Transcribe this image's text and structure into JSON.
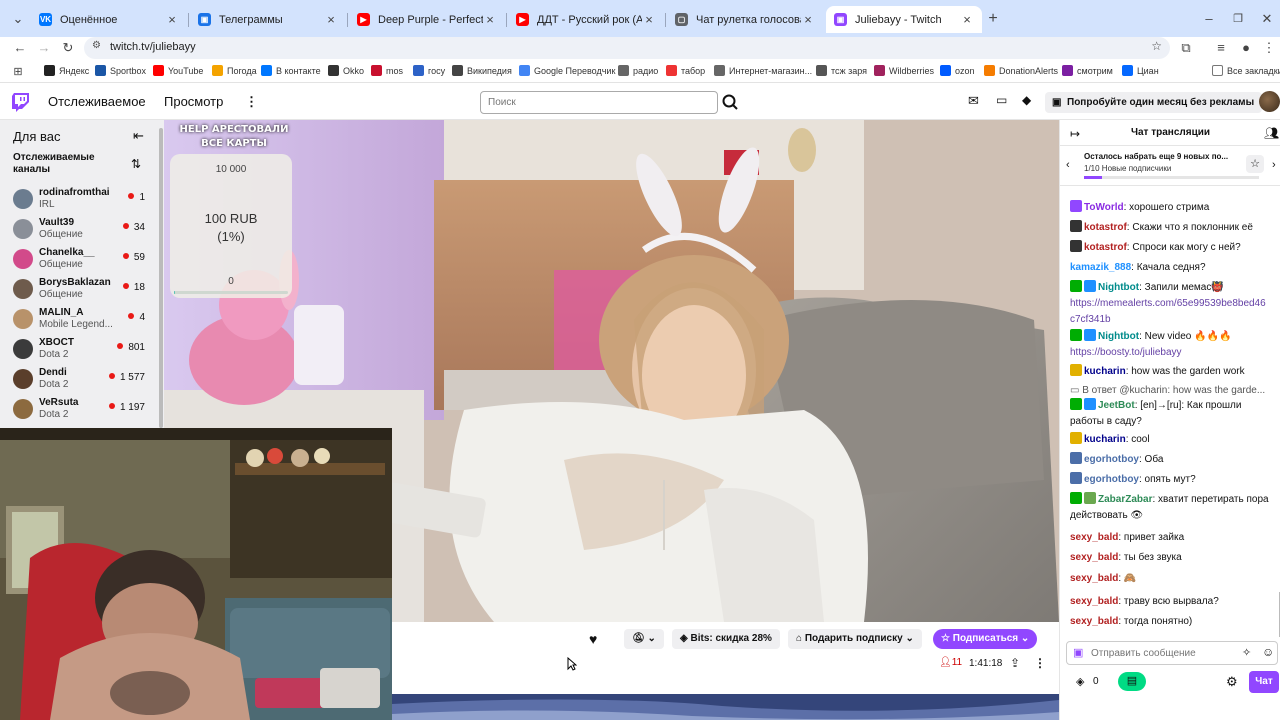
{
  "browser": {
    "tabs": [
      {
        "title": "Оценённое",
        "color": "#0077ff",
        "glyph": "VK"
      },
      {
        "title": "Телеграммы",
        "color": "#1a73e8",
        "glyph": "▣"
      },
      {
        "title": "Deep Purple - Perfect Strangers",
        "color": "#ff0000",
        "glyph": "▶"
      },
      {
        "title": "ДДТ - Русский рок (Аудио) - YouTube",
        "color": "#ff0000",
        "glyph": "▶"
      },
      {
        "title": "Чат рулетка голосовая — Nekto",
        "color": "#5f6368",
        "glyph": "▢"
      },
      {
        "title": "Juliebayy - Twitch",
        "color": "#9146ff",
        "glyph": "▣"
      }
    ],
    "new_tab": "+",
    "url": "twitch.tv/juliebayy",
    "bookmarks": [
      {
        "label": "Яндекс",
        "color": "#222"
      },
      {
        "label": "Sportbox",
        "color": "#1a56a6"
      },
      {
        "label": "YouTube",
        "color": "#ff0000"
      },
      {
        "label": "Погода",
        "color": "#f4a300"
      },
      {
        "label": "В контакте",
        "color": "#0077ff"
      },
      {
        "label": "Okko",
        "color": "#333"
      },
      {
        "label": "mos",
        "color": "#c8102e"
      },
      {
        "label": "госу",
        "color": "#2d62c7"
      },
      {
        "label": "Википедия",
        "color": "#444"
      },
      {
        "label": "Google Переводчик",
        "color": "#4285f4"
      },
      {
        "label": "радио",
        "color": "#666"
      },
      {
        "label": "табор",
        "color": "#e33"
      },
      {
        "label": "Интернет-магазин...",
        "color": "#666"
      },
      {
        "label": "тсж заря",
        "color": "#555"
      },
      {
        "label": "Wildberries",
        "color": "#a0225d"
      },
      {
        "label": "ozon",
        "color": "#005bff"
      },
      {
        "label": "DonationAlerts",
        "color": "#f57c00"
      },
      {
        "label": "смотрим",
        "color": "#7b1fa2"
      },
      {
        "label": "Циан",
        "color": "#0468ff"
      }
    ],
    "all_bookmarks": "Все закладки"
  },
  "nav": {
    "following": "Отслеживаемое",
    "browse": "Просмотр",
    "search_placeholder": "Поиск",
    "promo": "Попробуйте один месяц без рекламы"
  },
  "sidebar": {
    "title": "Для вас",
    "section": "Отслеживаемые каналы",
    "channels": [
      {
        "name": "rodinafromthai",
        "game": "IRL",
        "viewers": "1",
        "color": "#6b7c8f"
      },
      {
        "name": "Vault39",
        "game": "Общение",
        "viewers": "34",
        "color": "#8a8f98"
      },
      {
        "name": "Chanelka__",
        "game": "Общение",
        "viewers": "59",
        "color": "#d24a8a"
      },
      {
        "name": "BorysBaklazan",
        "game": "Общение",
        "viewers": "18",
        "color": "#6e5b4c"
      },
      {
        "name": "MALIN_A",
        "game": "Mobile Legend...",
        "viewers": "4",
        "color": "#b8926a"
      },
      {
        "name": "XBOCT",
        "game": "Dota 2",
        "viewers": "801",
        "color": "#3b3b3b"
      },
      {
        "name": "Dendi",
        "game": "Dota 2",
        "viewers": "1 577",
        "color": "#5a3e2b"
      },
      {
        "name": "VeRsuta",
        "game": "Dota 2",
        "viewers": "1 197",
        "color": "#8c6a3f"
      }
    ]
  },
  "overlay": {
    "title": "HELP АРЕСТОВАЛИ ВСЕ КАРТЫ",
    "goal_top": "10 000",
    "amount": "100 RUB",
    "percent": "(1%)",
    "goal_bottom": "0",
    "progress": 0.01
  },
  "player": {
    "bits": "Bits: скидка 28%",
    "gift": "Подарить подписку",
    "subscribe": "Подписаться",
    "viewers": "11",
    "uptime": "1:41:18"
  },
  "chat": {
    "title": "Чат трансляции",
    "goal_text": "Осталось набрать еще 9 новых по...",
    "goal_sub": "1/10 Новые подписчики",
    "goal_progress": 0.1,
    "messages": [
      {
        "user": "ToWorld",
        "color": "#8a2be2",
        "text": ": хорошего стрима",
        "badges": [
          "#9147ff"
        ]
      },
      {
        "user": "kotastrof",
        "color": "#b22222",
        "text": ": Скажи что я поклонник её",
        "badges": [
          "#333333"
        ]
      },
      {
        "user": "kotastrof",
        "color": "#b22222",
        "text": ": Спроси как могу с ней?",
        "badges": [
          "#333333"
        ]
      },
      {
        "user": "kamazik_888",
        "color": "#1e90ff",
        "text": ": Качала седня?",
        "badges": []
      },
      {
        "user": "Nightbot",
        "color": "#008b8b",
        "text": ": Запили мемас👹",
        "link": "https://memealerts.com/65e99539be8bed46c7cf341b",
        "badges": [
          "#00ad03",
          "#1e90ff"
        ]
      },
      {
        "user": "Nightbot",
        "color": "#008b8b",
        "text": ": New video 🔥🔥🔥",
        "link": "https://boosty.to/juliebayy",
        "badges": [
          "#00ad03",
          "#1e90ff"
        ]
      },
      {
        "user": "kucharin",
        "color": "#00008b",
        "text": ": how was the garden work",
        "badges": [
          "#e1b000"
        ]
      },
      {
        "user": "",
        "color": "#555",
        "text": "В ответ @kucharin: how was the garde...",
        "badges": [],
        "reply": true
      },
      {
        "user": "JeetBot",
        "color": "#2e8b57",
        "text": ": [en]→[ru]: Как прошли работы в саду?",
        "badges": [
          "#00ad03",
          "#1e90ff"
        ]
      },
      {
        "user": "kucharin",
        "color": "#00008b",
        "text": ": cool",
        "badges": [
          "#e1b000"
        ]
      },
      {
        "user": "egorhotboy",
        "color": "#4b6ea8",
        "text": ": Оба",
        "badges": [
          "#4b6ea8"
        ]
      },
      {
        "user": "egorhotboy",
        "color": "#4b6ea8",
        "text": ": опять мут?",
        "badges": [
          "#4b6ea8"
        ]
      },
      {
        "user": "ZabarZabar",
        "color": "#2e8b57",
        "text": ": хватит перетирать пора действовать 👁",
        "badges": [
          "#00ad03",
          "#6aa84f"
        ]
      },
      {
        "user": "sexy_bald",
        "color": "#b22222",
        "text": ": привет зайка",
        "badges": []
      },
      {
        "user": "sexy_bald",
        "color": "#b22222",
        "text": ": ты без звука",
        "badges": []
      },
      {
        "user": "sexy_bald",
        "color": "#b22222",
        "text": ": 🙈",
        "badges": []
      },
      {
        "user": "sexy_bald",
        "color": "#b22222",
        "text": ": траву всю вырвала?",
        "badges": []
      },
      {
        "user": "sexy_bald",
        "color": "#b22222",
        "text": ": тогда понятно)",
        "badges": []
      }
    ],
    "input_placeholder": "Отправить сообщение",
    "points": "0",
    "send": "Чат"
  }
}
